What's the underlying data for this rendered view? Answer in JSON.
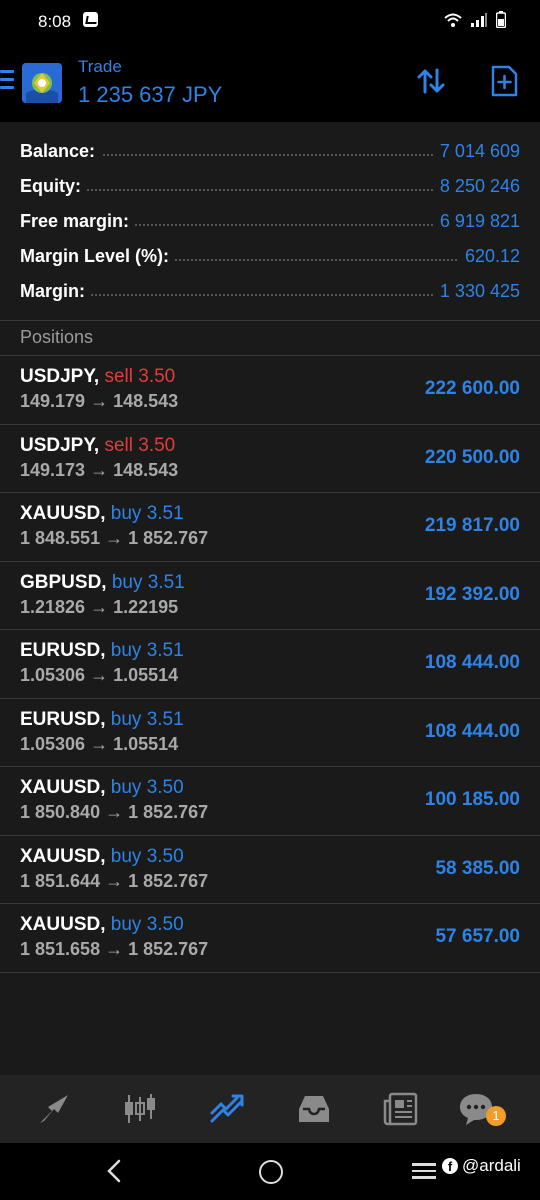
{
  "status_bar": {
    "time": "8:08"
  },
  "header": {
    "title": "Trade",
    "balance_display": "1 235 637 JPY"
  },
  "summary": [
    {
      "label": "Balance:",
      "value": "7 014 609"
    },
    {
      "label": "Equity:",
      "value": "8 250 246"
    },
    {
      "label": "Free margin:",
      "value": "6 919 821"
    },
    {
      "label": "Margin Level (%):",
      "value": "620.12"
    },
    {
      "label": "Margin:",
      "value": "1 330 425"
    }
  ],
  "positions": {
    "heading": "Positions",
    "items": [
      {
        "symbol": "USDJPY,",
        "side": "sell 3.50",
        "prices": "149.179 → 148.543",
        "profit": "222 600.00"
      },
      {
        "symbol": "USDJPY,",
        "side": "sell 3.50",
        "prices": "149.173 → 148.543",
        "profit": "220 500.00"
      },
      {
        "symbol": "XAUUSD,",
        "side": "buy 3.51",
        "prices": "1 848.551 → 1 852.767",
        "profit": "219 817.00"
      },
      {
        "symbol": "GBPUSD,",
        "side": "buy 3.51",
        "prices": "1.21826 → 1.22195",
        "profit": "192 392.00"
      },
      {
        "symbol": "EURUSD,",
        "side": "buy 3.51",
        "prices": "1.05306 → 1.05514",
        "profit": "108 444.00"
      },
      {
        "symbol": "EURUSD,",
        "side": "buy 3.51",
        "prices": "1.05306 → 1.05514",
        "profit": "108 444.00"
      },
      {
        "symbol": "XAUUSD,",
        "side": "buy 3.50",
        "prices": "1 850.840 → 1 852.767",
        "profit": "100 185.00"
      },
      {
        "symbol": "XAUUSD,",
        "side": "buy 3.50",
        "prices": "1 851.644 → 1 852.767",
        "profit": "58 385.00"
      },
      {
        "symbol": "XAUUSD,",
        "side": "buy 3.50",
        "prices": "1 851.658 → 1 852.767",
        "profit": "57 657.00"
      }
    ]
  },
  "bottom_nav": {
    "items": [
      "quotes-icon",
      "chart-icon",
      "trade-icon",
      "history-icon",
      "news-icon",
      "chat-icon"
    ],
    "chat_badge": "1"
  },
  "watermark": "@ardali",
  "colors": {
    "accent": "#2d83e6",
    "sell": "#e33b3b",
    "background": "#1a1a1a"
  }
}
